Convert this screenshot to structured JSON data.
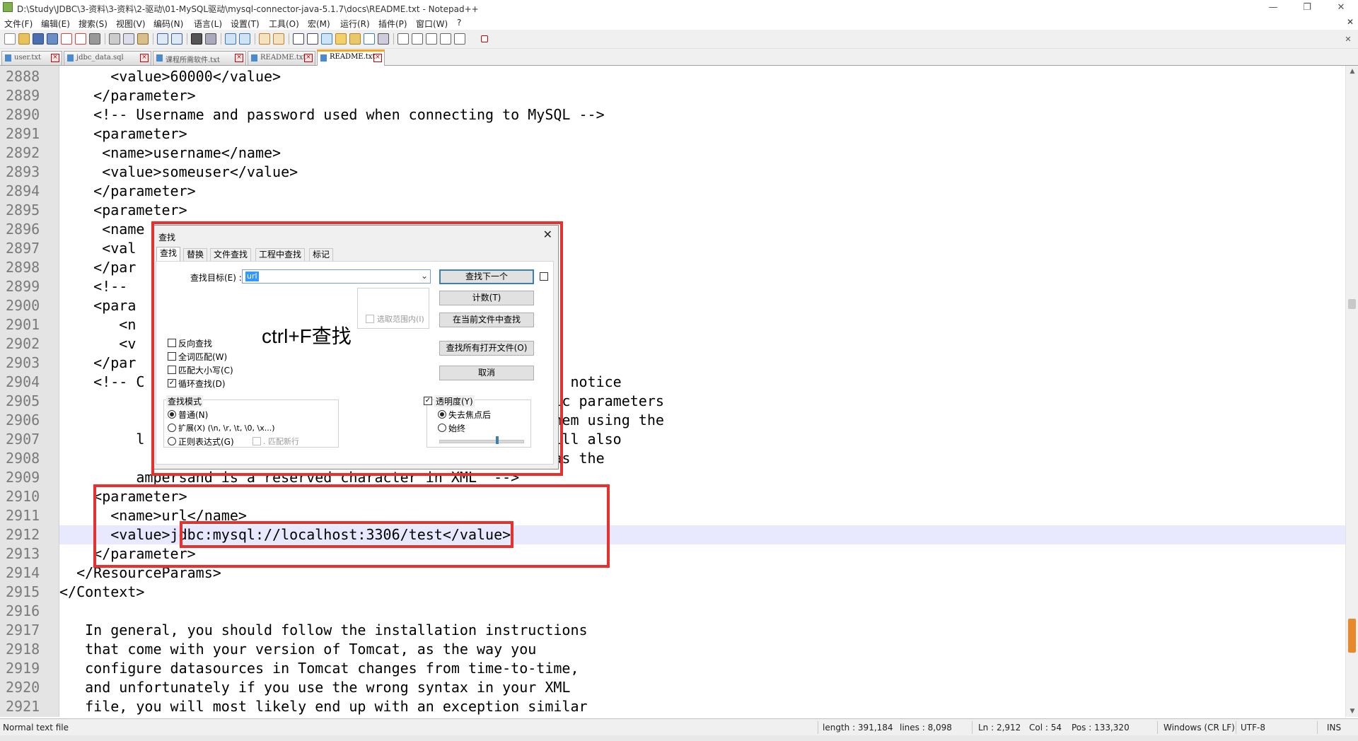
{
  "window": {
    "title": "D:\\Study\\JDBC\\3-资料\\3-资料\\2-驱动\\01-MySQL驱动\\mysql-connector-java-5.1.7\\docs\\README.txt - Notepad++",
    "minimize": "—",
    "restore": "❐",
    "close": "✕"
  },
  "menu": {
    "items": [
      "文件(F)",
      "编辑(E)",
      "搜索(S)",
      "视图(V)",
      "编码(N)",
      "语言(L)",
      "设置(T)",
      "工具(O)",
      "宏(M)",
      "运行(R)",
      "插件(P)",
      "窗口(W)",
      "?"
    ],
    "close": "✕"
  },
  "toolbar": {
    "icons": [
      "new-file-icon",
      "open-file-icon",
      "save-icon",
      "save-all-icon",
      "close-icon",
      "close-all-icon",
      "print-icon",
      "cut-icon",
      "copy-icon",
      "paste-icon",
      "undo-icon",
      "redo-icon",
      "find-icon",
      "replace-icon",
      "zoom-in-icon",
      "zoom-out-icon",
      "sync-v-icon",
      "sync-h-icon",
      "word-wrap-icon",
      "show-all-chars-icon",
      "indent-guide-icon",
      "doc-map-icon",
      "function-list-icon",
      "folder-as-workspace-icon",
      "monitoring-icon",
      "record-macro-icon",
      "stop-record-icon",
      "play-macro-icon",
      "play-multiple-icon",
      "save-macro-icon"
    ]
  },
  "tabs": [
    {
      "label": "user.txt",
      "active": false
    },
    {
      "label": "jdbc_data.sql",
      "active": false
    },
    {
      "label": "课程所需软件.txt",
      "active": false
    },
    {
      "label": "README.txt",
      "active": false
    },
    {
      "label": "README.txt",
      "active": true
    }
  ],
  "editor": {
    "current_line": "2912",
    "lines": [
      {
        "num": "2888",
        "text": "      <value>60000</value>"
      },
      {
        "num": "2889",
        "text": "    </parameter>"
      },
      {
        "num": "2890",
        "text": "    <!-- Username and password used when connecting to MySQL -->"
      },
      {
        "num": "2891",
        "text": "    <parameter>"
      },
      {
        "num": "2892",
        "text": "     <name>username</name>"
      },
      {
        "num": "2893",
        "text": "     <value>someuser</value>"
      },
      {
        "num": "2894",
        "text": "    </parameter>"
      },
      {
        "num": "2895",
        "text": "    <parameter>"
      },
      {
        "num": "2896",
        "text": "     <name"
      },
      {
        "num": "2897",
        "text": "     <val"
      },
      {
        "num": "2898",
        "text": "    </par"
      },
      {
        "num": "2899",
        "text": "    <!-- "
      },
      {
        "num": "2900",
        "text": "    <para"
      },
      {
        "num": "2901",
        "text": "       <n"
      },
      {
        "num": "2902",
        "text": "       <v"
      },
      {
        "num": "2903",
        "text": "    </par"
      },
      {
        "num": "2904",
        "text": "    <!-- C                                           MySQL, notice"
      },
      {
        "num": "2905",
        "text": "                                                     pecific parameters"
      },
      {
        "num": "2906",
        "text": "                                                     ing them using the"
      },
      {
        "num": "2907",
        "text": "         l                                           you will also"
      },
      {
        "num": "2908",
        "text": "                                                     lues as the"
      },
      {
        "num": "2909",
        "text": "         ampersand is a reserved character in XML  -->"
      },
      {
        "num": "2910",
        "text": "    <parameter>"
      },
      {
        "num": "2911",
        "text": "      <name>url</name>"
      },
      {
        "num": "2912",
        "text": "      <value>jdbc:mysql://localhost:3306/test</value>"
      },
      {
        "num": "2913",
        "text": "    </parameter>"
      },
      {
        "num": "2914",
        "text": "  </ResourceParams>"
      },
      {
        "num": "2915",
        "text": "</Context>"
      },
      {
        "num": "2916",
        "text": ""
      },
      {
        "num": "2917",
        "text": "   In general, you should follow the installation instructions"
      },
      {
        "num": "2918",
        "text": "   that come with your version of Tomcat, as the way you"
      },
      {
        "num": "2919",
        "text": "   configure datasources in Tomcat changes from time-to-time,"
      },
      {
        "num": "2920",
        "text": "   and unfortunately if you use the wrong syntax in your XML"
      },
      {
        "num": "2921",
        "text": "   file, you will most likely end up with an exception similar"
      }
    ]
  },
  "statusbar": {
    "file_type": "Normal text file",
    "length": "length : 391,184",
    "lines": "lines : 8,098",
    "ln": "Ln : 2,912",
    "col": "Col : 54",
    "pos": "Pos : 133,320",
    "eol": "Windows (CR LF)",
    "encoding": "UTF-8",
    "mode": "INS"
  },
  "find_dialog": {
    "title": "查找",
    "close": "✕",
    "tabs": [
      "查找",
      "替换",
      "文件查找",
      "工程中查找",
      "标记"
    ],
    "find_what_label": "查找目标(E) :",
    "find_what_value": "url",
    "buttons": {
      "find_next": "查找下一个",
      "count": "计数(T)",
      "find_all_current": "在当前文件中查找",
      "find_all_open": "查找所有打开文件(O)",
      "cancel": "取消"
    },
    "in_selection": "选取范围内(I)",
    "options": [
      {
        "label": "反向查找",
        "checked": false
      },
      {
        "label": "全词匹配(W)",
        "checked": false
      },
      {
        "label": "匹配大小写(C)",
        "checked": false
      },
      {
        "label": "循环查找(D)",
        "checked": true
      }
    ],
    "search_mode": {
      "title": "查找模式",
      "options": [
        {
          "label": "普通(N)",
          "checked": true
        },
        {
          "label": "扩展(X) (\\n, \\r, \\t, \\0, \\x...)",
          "checked": false
        },
        {
          "label": "正则表达式(G)",
          "checked": false
        }
      ],
      "dot_matches_newline": ". 匹配新行"
    },
    "transparency": {
      "title": "透明度(Y)",
      "checked": true,
      "options": [
        {
          "label": "失去焦点后",
          "checked": true
        },
        {
          "label": "始终",
          "checked": false
        }
      ],
      "level": 0.6
    }
  },
  "annotation": {
    "text": "ctrl+F查找",
    "color": "#e8312e"
  }
}
